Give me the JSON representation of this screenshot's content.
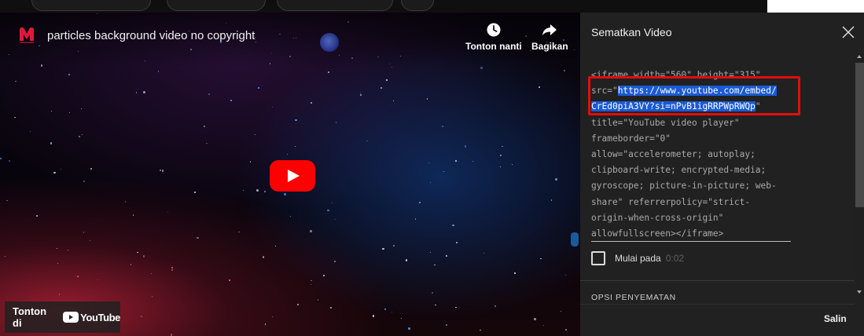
{
  "player": {
    "title": "particles background video no copyright",
    "watch_later_label": "Tonton nanti",
    "share_label": "Bagikan",
    "watch_on_label": "Tonton di",
    "youtube_word": "YouTube",
    "icons": {
      "channel": "channel-logo-icon",
      "watch_later": "clock-icon",
      "share": "share-arrow-icon",
      "play": "play-icon",
      "youtube": "youtube-logo-icon"
    },
    "colors": {
      "youtube_red": "#ff0000",
      "channel_logo": "#e3173e"
    }
  },
  "embed_dialog": {
    "title": "Sematkan Video",
    "code_lines": [
      {
        "pre": "<iframe width=\"560\" height=\"315\"",
        "hl": "",
        "post": ""
      },
      {
        "pre": "src=\"",
        "hl": "https://www.youtube.com/embed/",
        "post": ""
      },
      {
        "pre": "",
        "hl": "CrEd0piA3VY?si=nPvB1igRRPWpRWQp",
        "post": "\""
      },
      {
        "pre": "title=\"YouTube video player\"",
        "hl": "",
        "post": ""
      },
      {
        "pre": "frameborder=\"0\"",
        "hl": "",
        "post": ""
      },
      {
        "pre": "allow=\"accelerometer; autoplay;",
        "hl": "",
        "post": ""
      },
      {
        "pre": "clipboard-write; encrypted-media;",
        "hl": "",
        "post": ""
      },
      {
        "pre": "gyroscope; picture-in-picture; web-",
        "hl": "",
        "post": ""
      },
      {
        "pre": "share\" referrerpolicy=\"strict-",
        "hl": "",
        "post": ""
      },
      {
        "pre": "origin-when-cross-origin\"",
        "hl": "",
        "post": ""
      },
      {
        "pre": "allowfullscreen></iframe>",
        "hl": "",
        "post": ""
      }
    ],
    "start_at_label": "Mulai pada",
    "start_at_time": "0:02",
    "start_at_checked": false,
    "options_heading": "OPSI PENYEMATAN",
    "copy_label": "Salin",
    "colors": {
      "highlight": "#1a5ad4",
      "annotation_box": "#e20d0d"
    }
  }
}
